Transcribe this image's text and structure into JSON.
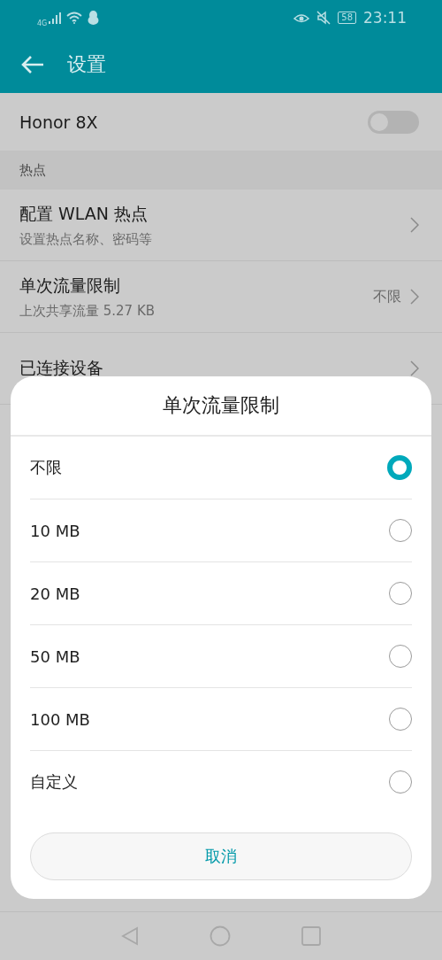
{
  "status_bar": {
    "network": "4G",
    "battery": "58",
    "time": "23:11"
  },
  "app_bar": {
    "title": "设置"
  },
  "device_toggle": {
    "label": "Honor 8X",
    "on": false
  },
  "section": {
    "title": "热点"
  },
  "rows": [
    {
      "title": "配置 WLAN 热点",
      "subtitle": "设置热点名称、密码等"
    },
    {
      "title": "单次流量限制",
      "subtitle": "上次共享流量 5.27 KB",
      "value": "不限"
    },
    {
      "title": "已连接设备"
    }
  ],
  "dialog": {
    "title": "单次流量限制",
    "options": [
      {
        "label": "不限",
        "selected": true
      },
      {
        "label": "10 MB",
        "selected": false
      },
      {
        "label": "20 MB",
        "selected": false
      },
      {
        "label": "50 MB",
        "selected": false
      },
      {
        "label": "100 MB",
        "selected": false
      },
      {
        "label": "自定义",
        "selected": false
      }
    ],
    "cancel": "取消"
  }
}
